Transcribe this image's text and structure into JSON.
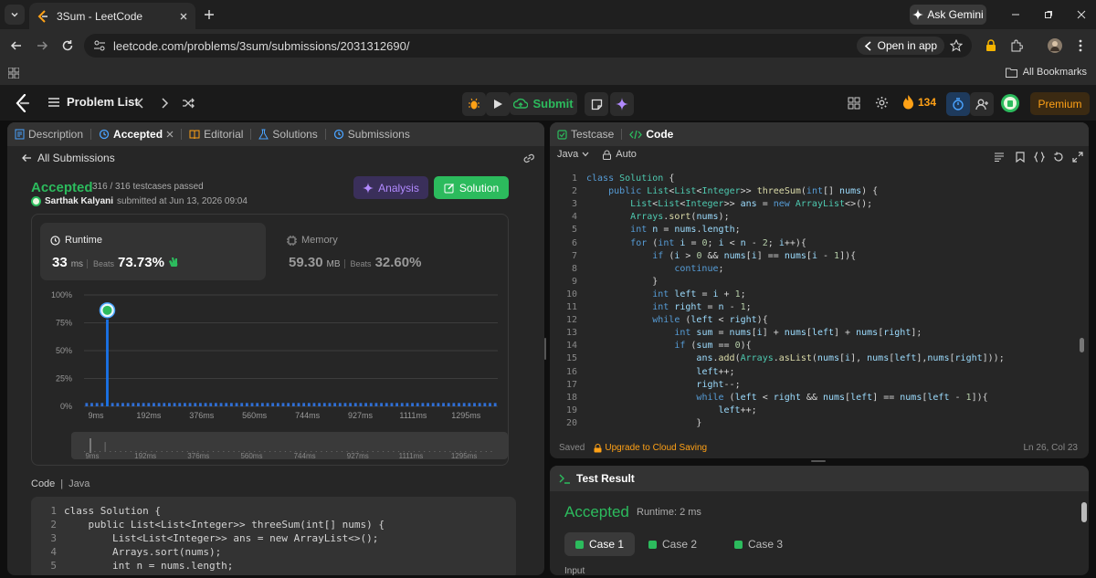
{
  "browser": {
    "tab_title": "3Sum - LeetCode",
    "url": "leetcode.com/problems/3sum/submissions/2031312690/",
    "open_in_app": "Open in app",
    "ask_gemini": "Ask Gemini",
    "all_bookmarks": "All Bookmarks"
  },
  "topbar": {
    "problem_list": "Problem List",
    "submit": "Submit",
    "streak": "134",
    "premium": "Premium"
  },
  "left_panel": {
    "tabs": [
      "Description",
      "Accepted",
      "Editorial",
      "Solutions",
      "Submissions"
    ],
    "back_label": "All Submissions",
    "status": "Accepted",
    "testcases": "316 / 316 testcases passed",
    "author": "Sarthak Kalyani",
    "submitted_at": "submitted at Jun 13, 2026 09:04",
    "analysis_btn": "Analysis",
    "solution_btn": "Solution",
    "runtime": {
      "label": "Runtime",
      "value": "33",
      "unit": "ms",
      "beats_label": "Beats",
      "beats": "73.73%"
    },
    "memory": {
      "label": "Memory",
      "value": "59.30",
      "unit": "MB",
      "beats_label": "Beats",
      "beats": "32.60%"
    },
    "code_label": "Code",
    "code_lang": "Java",
    "code_lines": [
      "class Solution {",
      "    public List<List<Integer>> threeSum(int[] nums) {",
      "        List<List<Integer>> ans = new ArrayList<>();",
      "        Arrays.sort(nums);",
      "        int n = nums.length;"
    ]
  },
  "chart_data": {
    "type": "bar",
    "yticks": [
      "100%",
      "75%",
      "50%",
      "25%",
      "0%"
    ],
    "xticks": [
      "9ms",
      "192ms",
      "376ms",
      "560ms",
      "744ms",
      "927ms",
      "1111ms",
      "1295ms"
    ],
    "ylim": [
      0,
      100
    ],
    "highlight_index": 4,
    "values": [
      3,
      3,
      3,
      3,
      78,
      3,
      3,
      3,
      3,
      3,
      3,
      3,
      3,
      3,
      3,
      3,
      3,
      3,
      3,
      3,
      3,
      3,
      3,
      3,
      3,
      3,
      3,
      3,
      3,
      3,
      3,
      3,
      3,
      3,
      3,
      3,
      3,
      3,
      3,
      3,
      3,
      3,
      3,
      3,
      3,
      3,
      3,
      3,
      3,
      3,
      3,
      3,
      3,
      3,
      3,
      3,
      3,
      3,
      3,
      3,
      3,
      3,
      3,
      3,
      3,
      3,
      3,
      3,
      3,
      3,
      3,
      3,
      3,
      3,
      3,
      3,
      3,
      3,
      3,
      3
    ]
  },
  "right_panel": {
    "testcase_tab": "Testcase",
    "code_tab": "Code",
    "language": "Java",
    "auto": "Auto",
    "lines": [
      [
        [
          "kw",
          "class "
        ],
        [
          "ty",
          "Solution "
        ],
        [
          "pl",
          "{"
        ]
      ],
      [
        [
          "pl",
          "    "
        ],
        [
          "kw",
          "public "
        ],
        [
          "ty",
          "List"
        ],
        [
          "pl",
          "<"
        ],
        [
          "ty",
          "List"
        ],
        [
          "pl",
          "<"
        ],
        [
          "ty",
          "Integer"
        ],
        [
          "pl",
          ">> "
        ],
        [
          "fn",
          "threeSum"
        ],
        [
          "pl",
          "("
        ],
        [
          "kw",
          "int"
        ],
        [
          "pl",
          "[] "
        ],
        [
          "va",
          "nums"
        ],
        [
          "pl",
          ") {"
        ]
      ],
      [
        [
          "pl",
          "        "
        ],
        [
          "ty",
          "List"
        ],
        [
          "pl",
          "<"
        ],
        [
          "ty",
          "List"
        ],
        [
          "pl",
          "<"
        ],
        [
          "ty",
          "Integer"
        ],
        [
          "pl",
          ">> "
        ],
        [
          "va",
          "ans"
        ],
        [
          "pl",
          " = "
        ],
        [
          "kw",
          "new "
        ],
        [
          "ty",
          "ArrayList"
        ],
        [
          "pl",
          "<>();"
        ]
      ],
      [
        [
          "pl",
          "        "
        ],
        [
          "ty",
          "Arrays"
        ],
        [
          "pl",
          "."
        ],
        [
          "fn",
          "sort"
        ],
        [
          "pl",
          "("
        ],
        [
          "va",
          "nums"
        ],
        [
          "pl",
          ");"
        ]
      ],
      [
        [
          "pl",
          "        "
        ],
        [
          "kw",
          "int "
        ],
        [
          "va",
          "n"
        ],
        [
          "pl",
          " = "
        ],
        [
          "va",
          "nums"
        ],
        [
          "pl",
          "."
        ],
        [
          "va",
          "length"
        ],
        [
          "pl",
          ";"
        ]
      ],
      [
        [
          "pl",
          "        "
        ],
        [
          "kw",
          "for "
        ],
        [
          "pl",
          "("
        ],
        [
          "kw",
          "int "
        ],
        [
          "va",
          "i"
        ],
        [
          "pl",
          " = "
        ],
        [
          "nu",
          "0"
        ],
        [
          "pl",
          "; "
        ],
        [
          "va",
          "i"
        ],
        [
          "pl",
          " < "
        ],
        [
          "va",
          "n"
        ],
        [
          "pl",
          " - "
        ],
        [
          "nu",
          "2"
        ],
        [
          "pl",
          "; "
        ],
        [
          "va",
          "i"
        ],
        [
          "pl",
          "++){"
        ]
      ],
      [
        [
          "pl",
          "            "
        ],
        [
          "kw",
          "if "
        ],
        [
          "pl",
          "("
        ],
        [
          "va",
          "i"
        ],
        [
          "pl",
          " > "
        ],
        [
          "nu",
          "0"
        ],
        [
          "pl",
          " && "
        ],
        [
          "va",
          "nums"
        ],
        [
          "pl",
          "["
        ],
        [
          "va",
          "i"
        ],
        [
          "pl",
          "] == "
        ],
        [
          "va",
          "nums"
        ],
        [
          "pl",
          "["
        ],
        [
          "va",
          "i"
        ],
        [
          "pl",
          " - "
        ],
        [
          "nu",
          "1"
        ],
        [
          "pl",
          "]){"
        ]
      ],
      [
        [
          "pl",
          "                "
        ],
        [
          "kw",
          "continue"
        ],
        [
          "pl",
          ";"
        ]
      ],
      [
        [
          "pl",
          "            }"
        ]
      ],
      [
        [
          "pl",
          "            "
        ],
        [
          "kw",
          "int "
        ],
        [
          "va",
          "left"
        ],
        [
          "pl",
          " = "
        ],
        [
          "va",
          "i"
        ],
        [
          "pl",
          " + "
        ],
        [
          "nu",
          "1"
        ],
        [
          "pl",
          ";"
        ]
      ],
      [
        [
          "pl",
          "            "
        ],
        [
          "kw",
          "int "
        ],
        [
          "va",
          "right"
        ],
        [
          "pl",
          " = "
        ],
        [
          "va",
          "n"
        ],
        [
          "pl",
          " - "
        ],
        [
          "nu",
          "1"
        ],
        [
          "pl",
          ";"
        ]
      ],
      [
        [
          "pl",
          "            "
        ],
        [
          "kw",
          "while "
        ],
        [
          "pl",
          "("
        ],
        [
          "va",
          "left"
        ],
        [
          "pl",
          " < "
        ],
        [
          "va",
          "right"
        ],
        [
          "pl",
          "){"
        ]
      ],
      [
        [
          "pl",
          "                "
        ],
        [
          "kw",
          "int "
        ],
        [
          "va",
          "sum"
        ],
        [
          "pl",
          " = "
        ],
        [
          "va",
          "nums"
        ],
        [
          "pl",
          "["
        ],
        [
          "va",
          "i"
        ],
        [
          "pl",
          "] + "
        ],
        [
          "va",
          "nums"
        ],
        [
          "pl",
          "["
        ],
        [
          "va",
          "left"
        ],
        [
          "pl",
          "] + "
        ],
        [
          "va",
          "nums"
        ],
        [
          "pl",
          "["
        ],
        [
          "va",
          "right"
        ],
        [
          "pl",
          "];"
        ]
      ],
      [
        [
          "pl",
          "                "
        ],
        [
          "kw",
          "if "
        ],
        [
          "pl",
          "("
        ],
        [
          "va",
          "sum"
        ],
        [
          "pl",
          " == "
        ],
        [
          "nu",
          "0"
        ],
        [
          "pl",
          "){"
        ]
      ],
      [
        [
          "pl",
          "                    "
        ],
        [
          "va",
          "ans"
        ],
        [
          "pl",
          "."
        ],
        [
          "fn",
          "add"
        ],
        [
          "pl",
          "("
        ],
        [
          "ty",
          "Arrays"
        ],
        [
          "pl",
          "."
        ],
        [
          "fn",
          "asList"
        ],
        [
          "pl",
          "("
        ],
        [
          "va",
          "nums"
        ],
        [
          "pl",
          "["
        ],
        [
          "va",
          "i"
        ],
        [
          "pl",
          "], "
        ],
        [
          "va",
          "nums"
        ],
        [
          "pl",
          "["
        ],
        [
          "va",
          "left"
        ],
        [
          "pl",
          "],"
        ],
        [
          "va",
          "nums"
        ],
        [
          "pl",
          "["
        ],
        [
          "va",
          "right"
        ],
        [
          "pl",
          "]));"
        ]
      ],
      [
        [
          "pl",
          "                    "
        ],
        [
          "va",
          "left"
        ],
        [
          "pl",
          "++;"
        ]
      ],
      [
        [
          "pl",
          "                    "
        ],
        [
          "va",
          "right"
        ],
        [
          "pl",
          "--;"
        ]
      ],
      [
        [
          "pl",
          "                    "
        ],
        [
          "kw",
          "while "
        ],
        [
          "pl",
          "("
        ],
        [
          "va",
          "left"
        ],
        [
          "pl",
          " < "
        ],
        [
          "va",
          "right"
        ],
        [
          "pl",
          " && "
        ],
        [
          "va",
          "nums"
        ],
        [
          "pl",
          "["
        ],
        [
          "va",
          "left"
        ],
        [
          "pl",
          "] == "
        ],
        [
          "va",
          "nums"
        ],
        [
          "pl",
          "["
        ],
        [
          "va",
          "left"
        ],
        [
          "pl",
          " - "
        ],
        [
          "nu",
          "1"
        ],
        [
          "pl",
          "]){"
        ]
      ],
      [
        [
          "pl",
          "                        "
        ],
        [
          "va",
          "left"
        ],
        [
          "pl",
          "++;"
        ]
      ],
      [
        [
          "pl",
          "                    }"
        ]
      ]
    ],
    "saved": "Saved",
    "upgrade": "Upgrade to Cloud Saving",
    "cursor": "Ln 26, Col 23"
  },
  "test_result": {
    "title": "Test Result",
    "status": "Accepted",
    "runtime": "Runtime: 2 ms",
    "cases": [
      "Case 1",
      "Case 2",
      "Case 3"
    ],
    "input_label": "Input"
  }
}
